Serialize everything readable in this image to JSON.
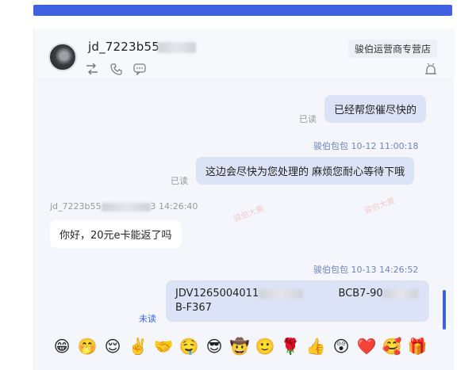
{
  "header": {
    "username": "jd_7223b55",
    "store_name": "骏伯运营商专营店"
  },
  "messages": [
    {
      "text": "已经帮您催尽快的",
      "status": "已读"
    },
    {
      "sender": "骏伯包包",
      "time": "10-12 11:00:18"
    },
    {
      "text": "这边会尽快为您处理的 麻烦您耐心等待下哦",
      "status": "已读"
    },
    {
      "sender": "jd_7223b55",
      "time": "3 14:26:40"
    },
    {
      "text": "你好，20元e卡能返了吗"
    },
    {
      "sender": "骏伯包包",
      "time": "10-13 14:26:52"
    },
    {
      "text_part1": "JDV1265004011",
      "text_part2": "BCB7-90",
      "text_part3": "B-F367",
      "status": "未读"
    }
  ],
  "emojis": [
    "😁",
    "🤭",
    "😌",
    "✌️",
    "🤝",
    "🤤",
    "😎",
    "🤠",
    "🙂",
    "🌹",
    "👍",
    "😲",
    "❤️",
    "🥰",
    "🎁"
  ],
  "watermark": "骏伯大黄"
}
